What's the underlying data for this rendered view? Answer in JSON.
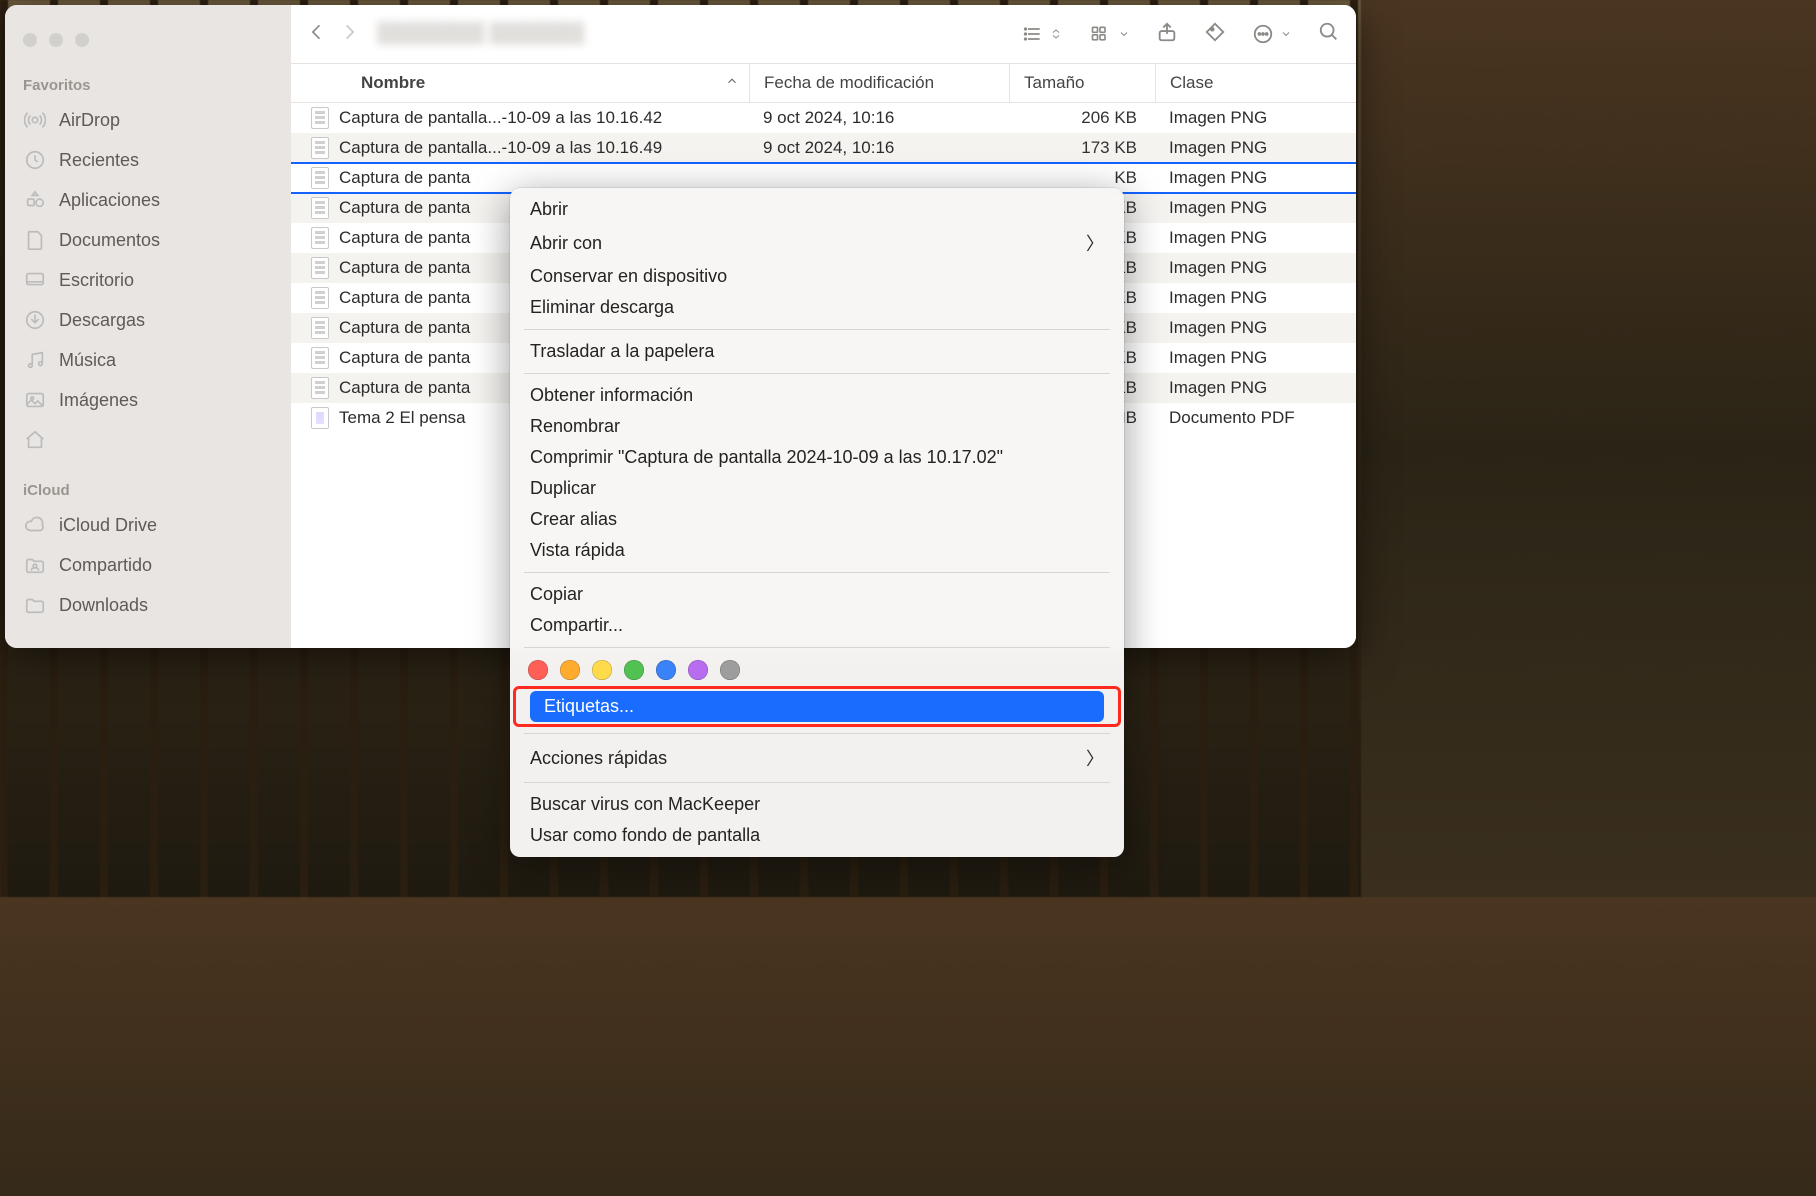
{
  "sidebar": {
    "favorites_title": "Favoritos",
    "items": [
      {
        "label": "AirDrop",
        "icon": "airdrop"
      },
      {
        "label": "Recientes",
        "icon": "recent"
      },
      {
        "label": "Aplicaciones",
        "icon": "apps"
      },
      {
        "label": "Documentos",
        "icon": "doc"
      },
      {
        "label": "Escritorio",
        "icon": "desktop"
      },
      {
        "label": "Descargas",
        "icon": "downloads"
      },
      {
        "label": "Música",
        "icon": "music"
      },
      {
        "label": "Imágenes",
        "icon": "images"
      },
      {
        "label": "",
        "icon": "home",
        "blur": true
      }
    ],
    "icloud_title": "iCloud",
    "icloud_items": [
      {
        "label": "iCloud Drive",
        "icon": "cloud"
      },
      {
        "label": "Compartido",
        "icon": "shared"
      },
      {
        "label": "Downloads",
        "icon": "folder"
      }
    ]
  },
  "toolbar": {
    "title": "████████ ███████"
  },
  "columns": {
    "name": "Nombre",
    "modified": "Fecha de modificación",
    "size": "Tamaño",
    "kind": "Clase"
  },
  "files": [
    {
      "name": "Captura de pantalla...-10-09 a las 10.16.42",
      "date": "9 oct 2024, 10:16",
      "size": "206 KB",
      "kind": "Imagen PNG",
      "type": "img"
    },
    {
      "name": "Captura de pantalla...-10-09 a las 10.16.49",
      "date": "9 oct 2024, 10:16",
      "size": "173 KB",
      "kind": "Imagen PNG",
      "type": "img"
    },
    {
      "name": "Captura de panta",
      "date": "",
      "size": "KB",
      "kind": "Imagen PNG",
      "type": "img",
      "selected": true
    },
    {
      "name": "Captura de panta",
      "date": "",
      "size": "KB",
      "kind": "Imagen PNG",
      "type": "img"
    },
    {
      "name": "Captura de panta",
      "date": "",
      "size": "KB",
      "kind": "Imagen PNG",
      "type": "img"
    },
    {
      "name": "Captura de panta",
      "date": "",
      "size": "KB",
      "kind": "Imagen PNG",
      "type": "img"
    },
    {
      "name": "Captura de panta",
      "date": "",
      "size": "KB",
      "kind": "Imagen PNG",
      "type": "img"
    },
    {
      "name": "Captura de panta",
      "date": "",
      "size": "KB",
      "kind": "Imagen PNG",
      "type": "img"
    },
    {
      "name": "Captura de panta",
      "date": "",
      "size": "KB",
      "kind": "Imagen PNG",
      "type": "img"
    },
    {
      "name": "Captura de panta",
      "date": "",
      "size": "KB",
      "kind": "Imagen PNG",
      "type": "img"
    },
    {
      "name": "Tema 2 El pensa",
      "date": "",
      "size": "MB",
      "kind": "Documento PDF",
      "type": "pdf"
    }
  ],
  "context_menu": {
    "groups": [
      [
        "Abrir",
        {
          "label": "Abrir con",
          "submenu": true
        },
        "Conservar en dispositivo",
        "Eliminar descarga"
      ],
      [
        "Trasladar a la papelera"
      ],
      [
        "Obtener información",
        "Renombrar",
        "Comprimir \"Captura de pantalla 2024-10-09 a las 10.17.02\"",
        "Duplicar",
        "Crear alias",
        "Vista rápida"
      ],
      [
        "Copiar",
        "Compartir..."
      ],
      [
        "__TAGS__",
        {
          "label": "Etiquetas...",
          "highlight": true,
          "redbox": true
        }
      ],
      [
        {
          "label": "Acciones rápidas",
          "submenu": true
        }
      ],
      [
        "Buscar virus con MacKeeper",
        "Usar como fondo de pantalla"
      ]
    ],
    "tag_colors": [
      "red",
      "orange",
      "yellow",
      "green",
      "blue",
      "purple",
      "gray"
    ]
  }
}
